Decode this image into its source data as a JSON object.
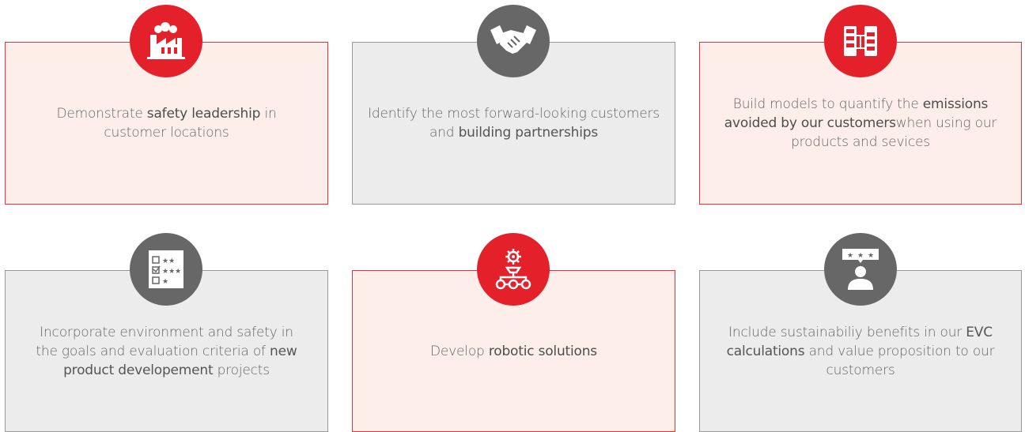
{
  "colors": {
    "accent_red": "#e4202b",
    "card_red_bg": "#fdeeea",
    "card_gray_bg": "#ececec",
    "badge_gray": "#676767",
    "text": "#666666"
  },
  "cards": [
    {
      "icon": "factory-icon",
      "pre": "Demonstrate ",
      "strong": "safety leadership",
      "post": " in customer locations"
    },
    {
      "icon": "handshake-icon",
      "pre": "Identify the most forward-looking customers and ",
      "strong": "building partnerships",
      "post": ""
    },
    {
      "icon": "flowchart-icon",
      "pre": "Build models to quantify the ",
      "strong": "emissions avoided by our customers",
      "post": "when using our products and sevices"
    },
    {
      "icon": "checklist-rating-icon",
      "pre": "Incorporate environment and safety in the goals and evaluation criteria of ",
      "strong": "new product developement",
      "post": " projects"
    },
    {
      "icon": "robotic-arm-icon",
      "pre": "Develop ",
      "strong": "robotic solutions",
      "post": ""
    },
    {
      "icon": "customer-rating-icon",
      "pre": "Include sustainabiliy benefits in our ",
      "strong": "EVC calculations",
      "post": " and value proposition to our customers"
    }
  ]
}
